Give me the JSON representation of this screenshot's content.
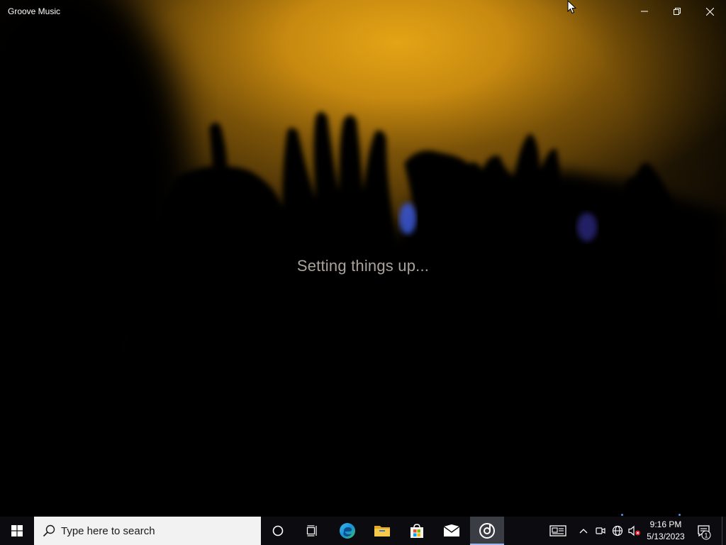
{
  "window": {
    "title": "Groove Music",
    "loading_text": "Setting things up...",
    "accent": "#e4a416"
  },
  "title_bar": {
    "minimize_icon": "minimize-icon",
    "restore_icon": "restore-icon",
    "close_icon": "close-icon"
  },
  "taskbar": {
    "search_placeholder": "Type here to search",
    "pinned_apps": [
      "start",
      "cortana",
      "task-view",
      "edge",
      "file-explorer",
      "microsoft-store",
      "mail",
      "groove-music"
    ],
    "active_app": "groove-music",
    "tray_icons": [
      "news-and-interests",
      "show-hidden-icons",
      "meet-now",
      "network",
      "volume-muted"
    ],
    "clock": {
      "time": "9:16 PM",
      "date": "5/13/2023"
    },
    "notifications_count": "1"
  }
}
